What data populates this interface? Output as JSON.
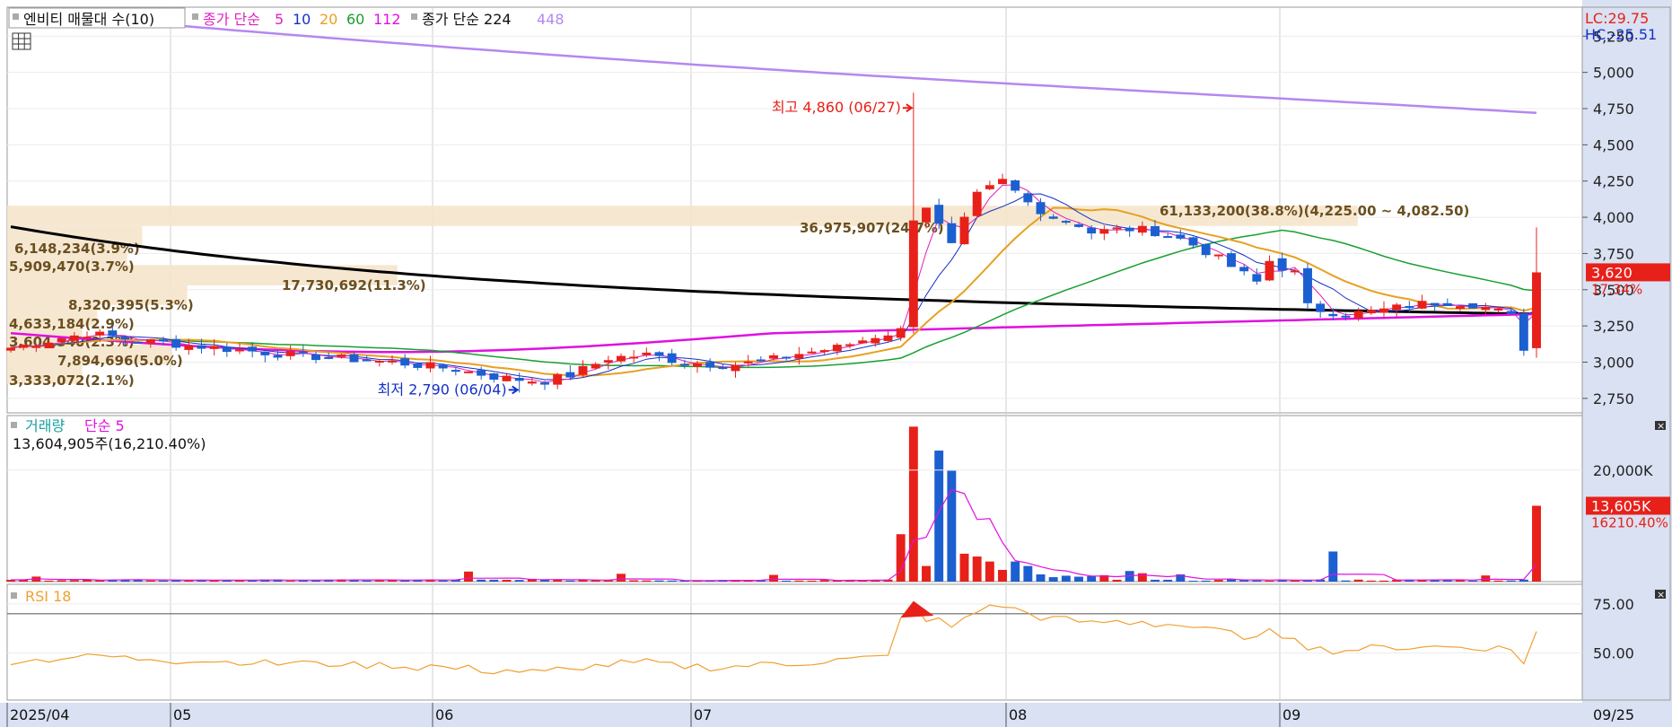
{
  "legend": {
    "price_title": "엔비티 매물대 수(10)",
    "ma_label": "종가 단순",
    "ma_periods": [
      "5",
      "10",
      "20",
      "60",
      "112"
    ],
    "ma_colors": [
      "#e020c0",
      "#1530c8",
      "#e8a020",
      "#18a030",
      "#e010e0"
    ],
    "ma2_label": "종가 단순 224",
    "ma2_period": "448",
    "ma2_color": "#b488f0"
  },
  "right_info": {
    "lc": "LC:29.75",
    "hc": "HC:-25.51"
  },
  "price_axis": {
    "ticks": [
      "5,250",
      "5,000",
      "4,750",
      "4,500",
      "4,250",
      "4,000",
      "3,750",
      "3,500",
      "3,250",
      "3,000",
      "2,750"
    ],
    "tick_values": [
      5250,
      5000,
      4750,
      4500,
      4250,
      4000,
      3750,
      3500,
      3250,
      3000,
      2750
    ],
    "ymin": 2650,
    "ymax": 5450
  },
  "current": {
    "price": "3,620",
    "pct": "17.34%"
  },
  "annotations": {
    "high": "최고 4,860 (06/27)",
    "low": "최저 2,790 (06/04)"
  },
  "volume_profile": [
    {
      "text": "61,133,200(38.8%)(4,225.00 ~ 4,082.50)",
      "low": 3940,
      "high": 4080,
      "frac": 0.9
    },
    {
      "text": "36,975,907(24.7%)",
      "low": 3940,
      "high": 4080,
      "frac": 0.57
    },
    {
      "text": "6,148,234(3.9%)",
      "low": 3805,
      "high": 3940,
      "frac": 0.09
    },
    {
      "text": "5,909,470(3.7%)",
      "low": 3670,
      "high": 3805,
      "frac": 0.08
    },
    {
      "text": "17,730,692(11.3%)",
      "low": 3530,
      "high": 3670,
      "frac": 0.26
    },
    {
      "text": "8,320,395(5.3%)",
      "low": 3395,
      "high": 3530,
      "frac": 0.12
    },
    {
      "text": "4,633,184(2.9%)",
      "low": 3255,
      "high": 3395,
      "frac": 0.06
    },
    {
      "text": "3,604,540(2.3%)",
      "low": 3120,
      "high": 3255,
      "frac": 0.05
    },
    {
      "text": "7,894,696(5.0%)",
      "low": 2985,
      "high": 3120,
      "frac": 0.11
    },
    {
      "text": "3,333,072(2.1%)",
      "low": 2850,
      "high": 2985,
      "frac": 0.05
    }
  ],
  "volume_panel": {
    "title": "거래량",
    "ma_label": "단순 5",
    "info": "13,604,905주(16,210.40%)",
    "tick": "20,000K",
    "tick_value": 20000,
    "ymax": 28500,
    "current": "13,605K",
    "current_pct": "16210.40%"
  },
  "rsi_panel": {
    "title": "RSI 18",
    "ticks": [
      "75.00",
      "50.00"
    ],
    "tick_values": [
      75,
      50
    ],
    "ymin": 26,
    "ymax": 85,
    "overbought": 70
  },
  "x_axis": {
    "labels": [
      "2025/04",
      "05",
      "06",
      "07",
      "08",
      "09"
    ],
    "end_label": "09/25"
  },
  "chart_data": {
    "type": "candlestick",
    "n": 121,
    "x_labels": [
      "2025/04",
      "05",
      "06",
      "07",
      "08",
      "09"
    ],
    "highlight_high": {
      "value": 4860,
      "date": "06/27"
    },
    "highlight_low": {
      "value": 2790,
      "date": "06/04"
    },
    "last_close": 3620,
    "last_volume_k": 13605
  }
}
